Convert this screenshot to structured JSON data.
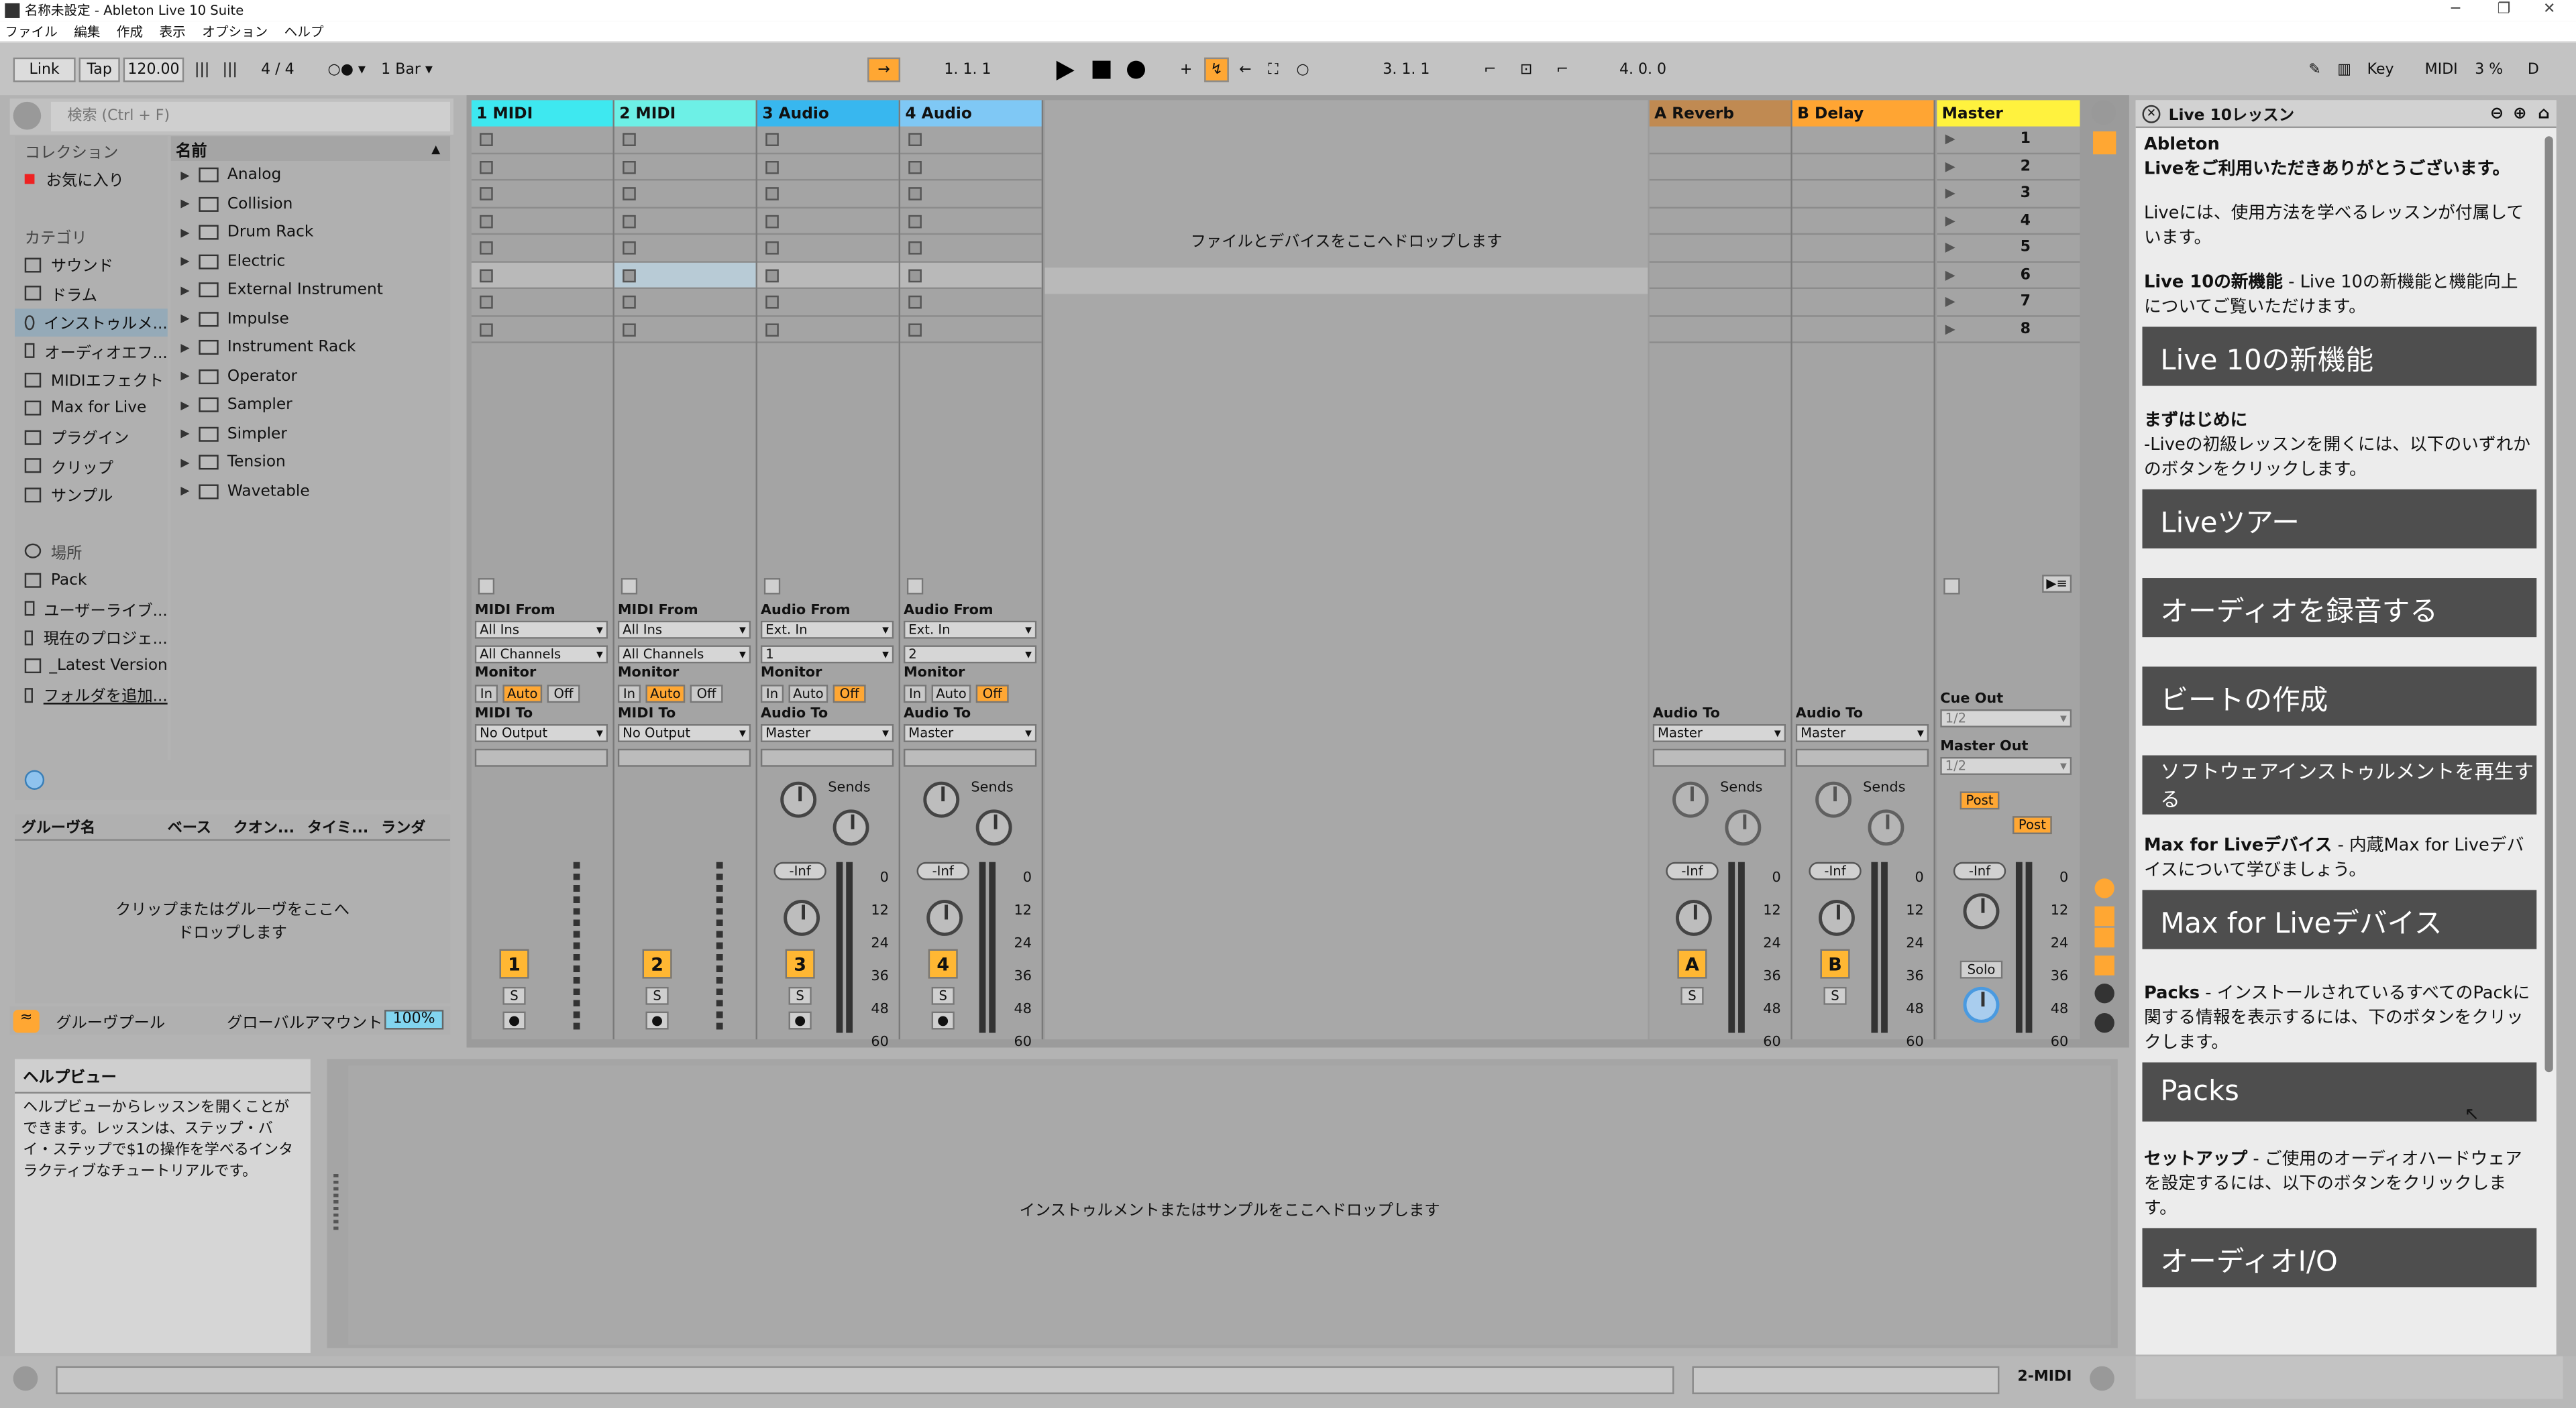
{
  "window": {
    "title": "名称未設定 - Ableton Live 10 Suite",
    "menu": [
      "ファイル",
      "編集",
      "作成",
      "表示",
      "オプション",
      "ヘルプ"
    ]
  },
  "control": {
    "link": "Link",
    "tap": "Tap",
    "tempo": "120.00",
    "sig_num": "4",
    "sig_den": "4",
    "quant": "1 Bar",
    "pos1": "1.  1.  1",
    "pos2": "3.  1.  1",
    "pos3": "4.  0.  0",
    "key": "Key",
    "midi": "MIDI",
    "cpu": "3 %",
    "d": "D"
  },
  "browser": {
    "search_placeholder": "検索 (Ctrl + F)",
    "collections_label": "コレクション",
    "favorites": "お気に入り",
    "categories_label": "カテゴリ",
    "categories": [
      "サウンド",
      "ドラム",
      "インストゥルメ...",
      "オーディオエフ...",
      "MIDIエフェクト",
      "Max for Live",
      "プラグイン",
      "クリップ",
      "サンプル"
    ],
    "places_label": "場所",
    "places": [
      "Pack",
      "ユーザーライブ...",
      "現在のプロジェ...",
      "_Latest Version",
      "フォルダを追加..."
    ],
    "name_header": "名前",
    "items": [
      "Analog",
      "Collision",
      "Drum Rack",
      "Electric",
      "External Instrument",
      "Impulse",
      "Instrument Rack",
      "Operator",
      "Sampler",
      "Simpler",
      "Tension",
      "Wavetable"
    ]
  },
  "groove": {
    "cols": [
      "グルーヴ名",
      "ベース",
      "クオン...",
      "タイミ...",
      "ランダ"
    ],
    "drop": "クリップまたはグルーヴをここへドロップします",
    "pool": "グルーヴプール",
    "global": "グローバルアマウント",
    "amount": "100%"
  },
  "help": {
    "title": "ヘルプビュー",
    "text": "ヘルプビューからレッスンを開くことができます。レッスンは、ステップ・バイ・ステップで$1の操作を学べるインタラクティブなチュートリアルです。"
  },
  "tracks": [
    {
      "name": "1 MIDI",
      "color": "#3ee8f0",
      "from": "MIDI From",
      "in1": "All Ins",
      "in2": "All Channels",
      "to": "MIDI To",
      "out": "No Output",
      "num": "1"
    },
    {
      "name": "2 MIDI",
      "color": "#6df0e6",
      "from": "MIDI From",
      "in1": "All Ins",
      "in2": "All Channels",
      "to": "MIDI To",
      "out": "No Output",
      "num": "2"
    },
    {
      "name": "3 Audio",
      "color": "#38b7ef",
      "from": "Audio From",
      "in1": "Ext. In",
      "in2": "1",
      "to": "Audio To",
      "out": "Master",
      "num": "3"
    },
    {
      "name": "4 Audio",
      "color": "#7fc8f5",
      "from": "Audio From",
      "in1": "Ext. In",
      "in2": "2",
      "to": "Audio To",
      "out": "Master",
      "num": "4"
    }
  ],
  "returns": [
    {
      "name": "A Reverb",
      "color": "#c08a52",
      "num": "A",
      "to": "Audio To",
      "out": "Master"
    },
    {
      "name": "B Delay",
      "color": "#ffa533",
      "num": "B",
      "to": "Audio To",
      "out": "Master"
    }
  ],
  "master": {
    "name": "Master",
    "color": "#fff23e",
    "scenes": [
      "1",
      "2",
      "3",
      "4",
      "5",
      "6",
      "7",
      "8"
    ],
    "cue": "Cue Out",
    "cue_val": "1/2",
    "mout": "Master Out",
    "mout_val": "1/2",
    "post": "Post",
    "solo": "Solo"
  },
  "session": {
    "drop": "ファイルとデバイスをここへドロップします",
    "monitor": "Monitor",
    "in": "In",
    "auto": "Auto",
    "off": "Off",
    "sends": "Sends",
    "inf": "-Inf",
    "s": "S",
    "scale": [
      "0",
      "12",
      "24",
      "36",
      "48",
      "60"
    ]
  },
  "device": {
    "drop": "インストゥルメントまたはサンプルをここへドロップします"
  },
  "status": {
    "midi": "2-MIDI"
  },
  "lesson": {
    "title": "Live 10レッスン",
    "p1": "Ableton",
    "p1b": "Liveをご利用いただきありがとうございます。",
    "p2": "Liveには、使用方法を学べるレッスンが付属しています。",
    "h3": "Live 10の新機能",
    "h3b": " - Live 10の新機能と機能向上についてご覧いただけます。",
    "b1": "Live 10の新機能",
    "h4": "まずはじめに",
    "p4": "-Liveの初級レッスンを開くには、以下のいずれかのボタンをクリックします。",
    "b2": "Liveツアー",
    "b3": "オーディオを録音する",
    "b4": "ビートの作成",
    "b5": "ソフトウェアインストゥルメントを再生する",
    "h5": "Max for Liveデバイス",
    "p5": " - 内蔵Max for Liveデバイスについて学びましょう。",
    "b6": "Max for Liveデバイス",
    "h6": "Packs",
    "p6": " - インストールされているすべてのPackに関する情報を表示するには、下のボタンをクリックします。",
    "b7": "Packs",
    "h7": "セットアップ",
    "p7": " - ご使用のオーディオハードウェアを設定するには、以下のボタンをクリックします。",
    "b8": "オーディオI/O"
  }
}
